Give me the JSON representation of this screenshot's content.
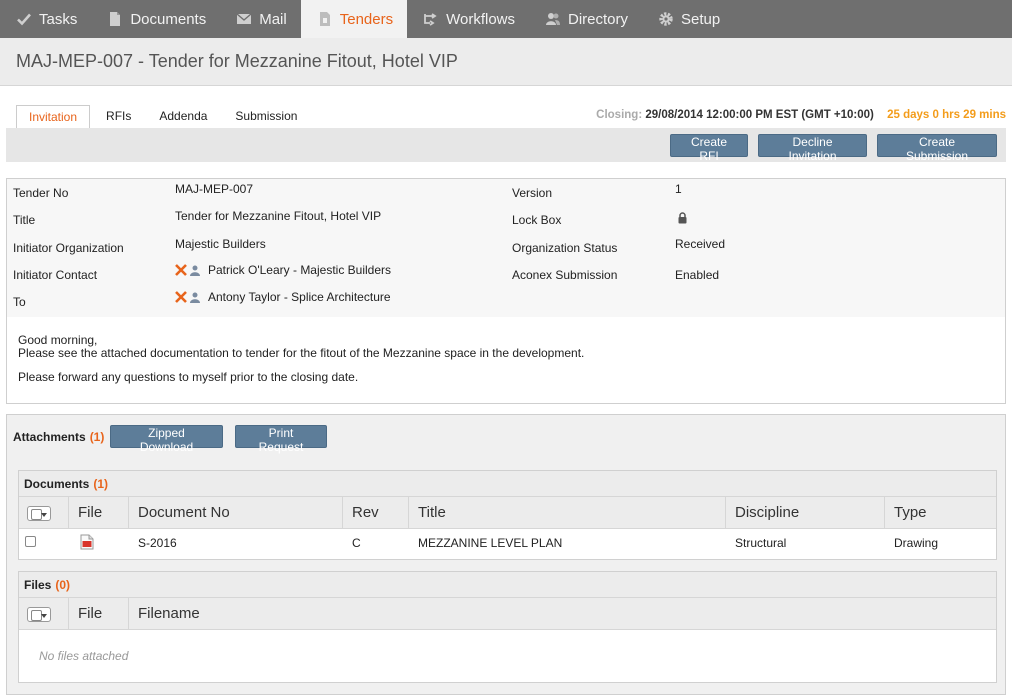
{
  "nav": {
    "items": [
      {
        "label": "Tasks",
        "icon": "check-icon"
      },
      {
        "label": "Documents",
        "icon": "document-icon"
      },
      {
        "label": "Mail",
        "icon": "mail-icon"
      },
      {
        "label": "Tenders",
        "icon": "tender-icon",
        "active": true
      },
      {
        "label": "Workflows",
        "icon": "workflow-icon"
      },
      {
        "label": "Directory",
        "icon": "people-icon"
      },
      {
        "label": "Setup",
        "icon": "gear-icon"
      }
    ]
  },
  "page": {
    "title": "MAJ-MEP-007 - Tender for Mezzanine Fitout, Hotel VIP"
  },
  "tabs": [
    "Invitation",
    "RFIs",
    "Addenda",
    "Submission"
  ],
  "closing": {
    "label": "Closing:",
    "datetime": "29/08/2014 12:00:00 PM EST (GMT +10:00)",
    "remaining": "25 days 0 hrs 29 mins"
  },
  "actions": {
    "create_rfi": "Create RFI",
    "decline": "Decline Invitation",
    "create_submission": "Create Submission"
  },
  "details": {
    "tender_no_label": "Tender No",
    "tender_no": "MAJ-MEP-007",
    "title_label": "Title",
    "title": "Tender for Mezzanine Fitout, Hotel VIP",
    "initiator_org_label": "Initiator Organization",
    "initiator_org": "Majestic Builders",
    "initiator_contact_label": "Initiator Contact",
    "initiator_contact": "Patrick O'Leary - Majestic Builders",
    "to_label": "To",
    "to": "Antony Taylor - Splice Architecture",
    "version_label": "Version",
    "version": "1",
    "lockbox_label": "Lock Box",
    "org_status_label": "Organization Status",
    "org_status": "Received",
    "aconex_submission_label": "Aconex Submission",
    "aconex_submission": "Enabled"
  },
  "message": {
    "line1": "Good morning,",
    "line2": "Please see the attached documentation to tender for the fitout of the Mezzanine space in the development.",
    "line3": "Please forward any questions to myself prior to the closing date."
  },
  "attachments": {
    "label": "Attachments",
    "count": "(1)",
    "zipped_download": "Zipped Download",
    "print_request": "Print Request"
  },
  "documents": {
    "label": "Documents",
    "count": "(1)",
    "columns": [
      "File",
      "Document No",
      "Rev",
      "Title",
      "Discipline",
      "Type"
    ],
    "rows": [
      {
        "document_no": "S-2016",
        "rev": "C",
        "title": "MEZZANINE LEVEL PLAN",
        "discipline": "Structural",
        "type": "Drawing"
      }
    ]
  },
  "files": {
    "label": "Files",
    "count": "(0)",
    "columns": [
      "File",
      "Filename"
    ],
    "empty_text": "No files attached"
  },
  "colors": {
    "nav_bg": "#6f6f6f",
    "accent": "#e8641b",
    "button": "#5d7d99",
    "remaining": "#f39c1a"
  }
}
